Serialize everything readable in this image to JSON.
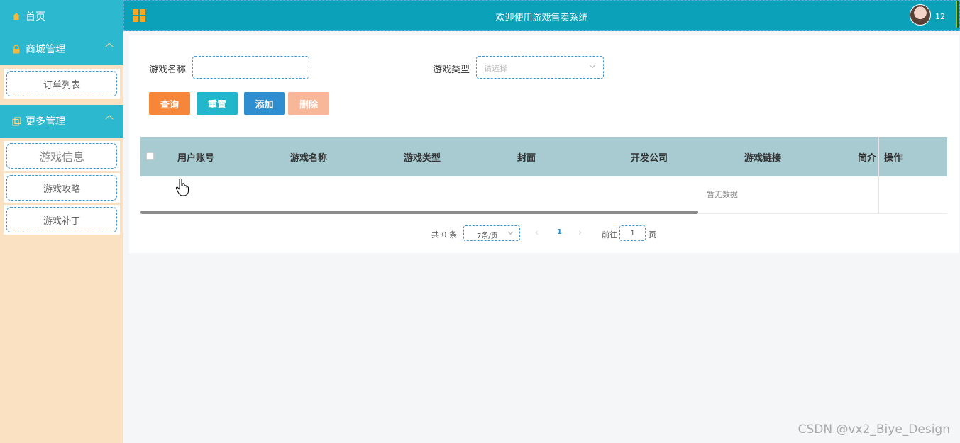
{
  "sidebar": {
    "home_label": "首页",
    "groups": [
      {
        "label": "商城管理",
        "items": [
          {
            "label": "订单列表"
          }
        ]
      },
      {
        "label": "更多管理",
        "items": [
          {
            "label": "游戏信息"
          },
          {
            "label": "游戏攻略"
          },
          {
            "label": "游戏补丁"
          }
        ]
      }
    ]
  },
  "header": {
    "title": "欢迎使用游戏售卖系统",
    "user_label": "12"
  },
  "search": {
    "name_label": "游戏名称",
    "name_value": "",
    "type_label": "游戏类型",
    "type_placeholder": "请选择"
  },
  "buttons": {
    "query": "查询",
    "reset": "重置",
    "add": "添加",
    "delete": "删除"
  },
  "table": {
    "columns": [
      "用户账号",
      "游戏名称",
      "游戏类型",
      "封面",
      "开发公司",
      "游戏链接",
      "简介",
      "操作"
    ],
    "empty_text": "暂无数据"
  },
  "pagination": {
    "total": "共 0 条",
    "page_size": "7条/页",
    "current_page": "1",
    "goto_label": "前往",
    "goto_value": "1",
    "page_suffix": "页"
  },
  "watermark": "CSDN @vx2_Biye_Design",
  "colors": {
    "header_bg": "#0ba1b9",
    "menu_bg": "#2cb8cf",
    "sidebar_bg": "#f9e1c2",
    "table_header_bg": "#a7cbd1",
    "btn_query": "#f5863a",
    "btn_reset": "#23b7cc",
    "btn_add": "#2f8ecf",
    "btn_delete": "#f9b79a"
  }
}
